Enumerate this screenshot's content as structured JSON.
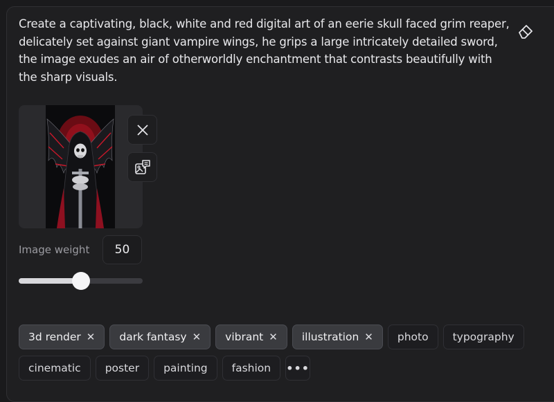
{
  "prompt": {
    "text": "Create a captivating, black, white and red digital art of an eerie skull faced grim reaper, delicately set against giant vampire wings, he grips a large intricately detailed sword, the image exudes an air of otherworldly enchantment that contrasts beautifully with the sharp visuals."
  },
  "actions": {
    "clear_icon": "eraser-icon",
    "remove_image_icon": "close-icon",
    "describe_image_icon": "image-comment-icon"
  },
  "image_weight": {
    "label": "Image weight",
    "value": "50",
    "slider_fraction": 0.5
  },
  "styles": {
    "row1": [
      {
        "label": "3d render",
        "selected": true
      },
      {
        "label": "dark fantasy",
        "selected": true
      },
      {
        "label": "vibrant",
        "selected": true
      },
      {
        "label": "illustration",
        "selected": true
      },
      {
        "label": "photo",
        "selected": false
      },
      {
        "label": "typography",
        "selected": false
      }
    ],
    "row2": [
      {
        "label": "cinematic",
        "selected": false
      },
      {
        "label": "poster",
        "selected": false
      },
      {
        "label": "painting",
        "selected": false
      },
      {
        "label": "fashion",
        "selected": false
      }
    ],
    "more_label": "•••",
    "remove_symbol": "✕"
  },
  "colors": {
    "background": "#1f1f21",
    "accent_red": "#c8182a",
    "chip_selected": "#3a3b3f"
  }
}
